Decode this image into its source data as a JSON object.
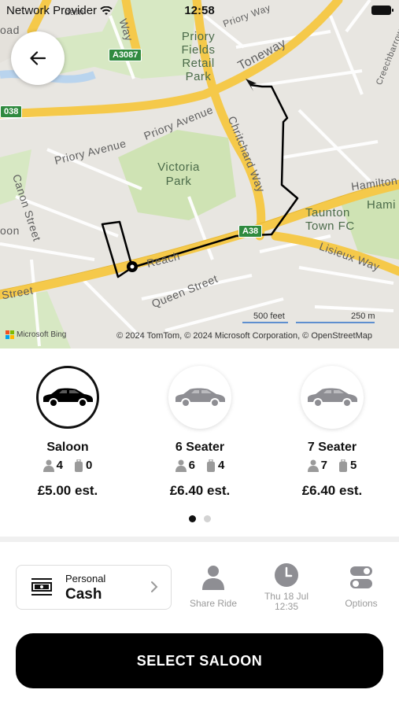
{
  "status_bar": {
    "carrier": "Network Provider",
    "time": "12:58"
  },
  "map": {
    "labels": {
      "priory_fields": "Priory Fields Retail Park",
      "toneway": "Toneway",
      "priory_avenue_1": "Priory Avenue",
      "priory_avenue_2": "Priory Avenue",
      "victoria_park": "Victoria Park",
      "chritchard_way": "Chritchard Way",
      "hamilton": "Hamilton",
      "hami": "Hami",
      "taunton_town_fc": "Taunton Town FC",
      "lisieux_way": "Lisieux Way",
      "canon_street": "Canon Street",
      "queen_street": "Queen Street",
      "east_reach": "Reach",
      "street_left": "Street",
      "creechbarrow_road": "Creechbarrow Road",
      "way_top": "Way",
      "priory_way": "Priory Way",
      "oad": "oad",
      "oon": "oon",
      "dam": "dam"
    },
    "shields": {
      "a3087": "A3087",
      "a38": "A38",
      "a38_left": "038"
    },
    "scale": {
      "feet": "500 feet",
      "meters": "250 m"
    },
    "logo_text": "Microsoft Bing",
    "attribution": "© 2024 TomTom, © 2024 Microsoft Corporation, © OpenStreetMap"
  },
  "vehicles": [
    {
      "name": "Saloon",
      "passengers": "4",
      "luggage": "0",
      "price": "£5.00 est.",
      "selected": true
    },
    {
      "name": "6 Seater",
      "passengers": "6",
      "luggage": "4",
      "price": "£6.40 est.",
      "selected": false
    },
    {
      "name": "7 Seater",
      "passengers": "7",
      "luggage": "5",
      "price": "£6.40 est.",
      "selected": false
    }
  ],
  "payment": {
    "label": "Personal",
    "value": "Cash"
  },
  "options": {
    "share_ride": "Share Ride",
    "datetime_line1": "Thu 18 Jul",
    "datetime_line2": "12:35",
    "options": "Options"
  },
  "select_button": "SELECT SALOON",
  "colors": {
    "accent": "#000000",
    "muted_icon": "#8e8e93",
    "road_major": "#f5c94a",
    "park": "#cfe3b4",
    "route": "#000000"
  },
  "icons": {
    "back": "arrow-left-icon",
    "car": "car-icon",
    "passenger": "person-icon",
    "luggage": "suitcase-icon",
    "cash": "banknote-icon",
    "chevron": "chevron-right-icon",
    "share": "person-icon",
    "clock": "clock-icon",
    "options": "toggle-icon"
  }
}
